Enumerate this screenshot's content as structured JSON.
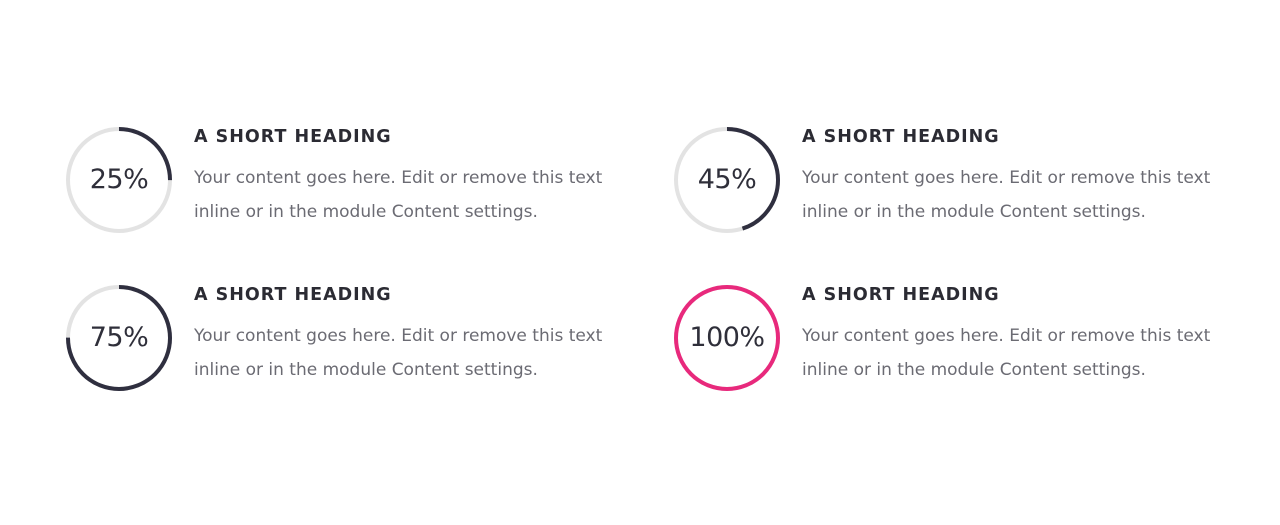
{
  "colors": {
    "track": "#e3e3e3",
    "progress_default": "#2f2f3f",
    "progress_complete": "#e8297c",
    "heading": "#2b2b33",
    "body": "#6b6b73"
  },
  "counters": [
    {
      "percent_label": "25%",
      "value": 25,
      "heading": "A SHORT HEADING",
      "body": "Your content goes here. Edit or remove this text inline or in the module Content settings."
    },
    {
      "percent_label": "45%",
      "value": 45,
      "heading": "A SHORT HEADING",
      "body": "Your content goes here. Edit or remove this text inline or in the module Content settings."
    },
    {
      "percent_label": "75%",
      "value": 75,
      "heading": "A SHORT HEADING",
      "body": "Your content goes here. Edit or remove this text inline or in the module Content settings."
    },
    {
      "percent_label": "100%",
      "value": 100,
      "heading": "A SHORT HEADING",
      "body": "Your content goes here. Edit or remove this text inline or in the module Content settings."
    }
  ]
}
